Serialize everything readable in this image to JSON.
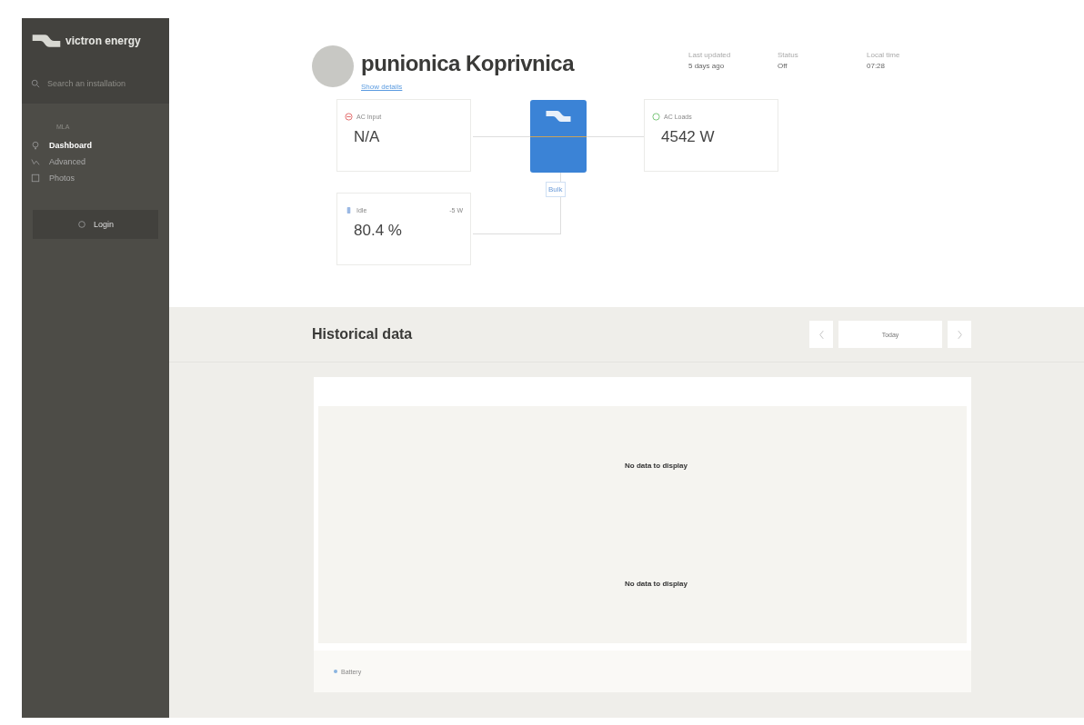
{
  "sidebar": {
    "brand": "victron energy",
    "search": {
      "placeholder": "Search an installation"
    },
    "section_label": "MLA",
    "items": [
      {
        "label": "Dashboard",
        "selected": true
      },
      {
        "label": "Advanced",
        "selected": false
      },
      {
        "label": "Photos",
        "selected": false
      }
    ],
    "login_button": "Login"
  },
  "header": {
    "title": "punionica Koprivnica",
    "details_link": "Show details",
    "stats": [
      {
        "label": "Last updated",
        "value": "5 days ago"
      },
      {
        "label": "Status",
        "value": "Off"
      },
      {
        "label": "Local time",
        "value": "07:28"
      }
    ]
  },
  "diagram": {
    "ac_input": {
      "label": "AC Input",
      "value": "N/A"
    },
    "ac_loads": {
      "label": "AC Loads",
      "value": "4542 W"
    },
    "battery": {
      "label": "Idle",
      "power": "-5 W",
      "value": "80.4 %"
    },
    "inverter_state": "Bulk"
  },
  "historical": {
    "title": "Historical data",
    "period": "Today",
    "messages": [
      "No data to display",
      "No data to display"
    ],
    "legend": [
      {
        "name": "Battery",
        "color": "#8ab4e0"
      }
    ]
  }
}
